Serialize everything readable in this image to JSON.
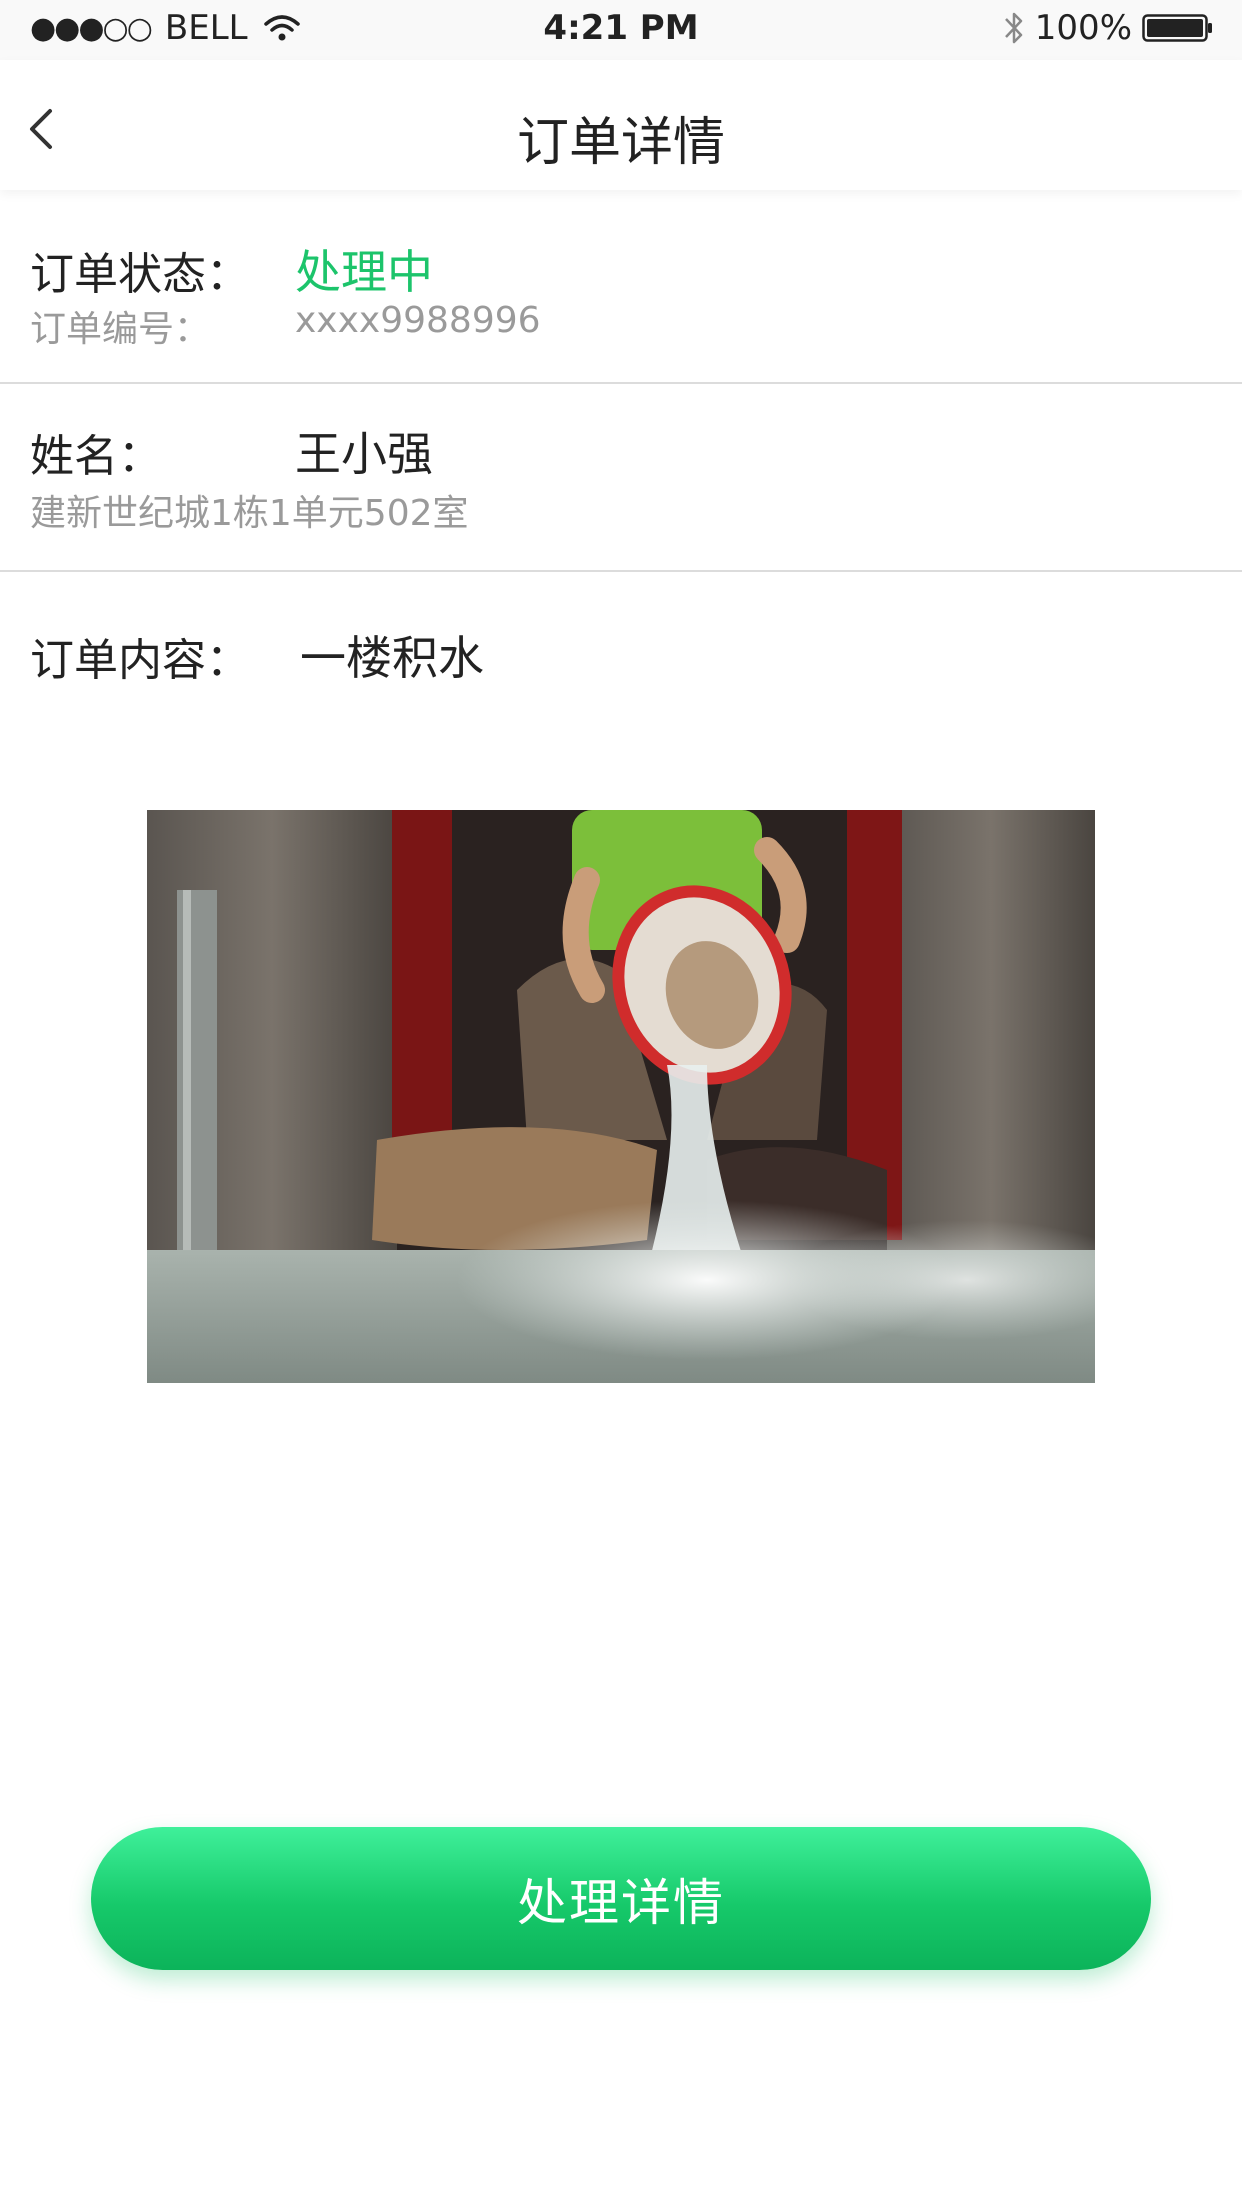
{
  "status_bar": {
    "signal_dots": "●●●○○",
    "carrier": "BELL",
    "time": "4:21 PM",
    "battery": "100%",
    "icons": [
      "wifi-icon",
      "bluetooth-icon",
      "battery-icon"
    ]
  },
  "nav": {
    "title": "订单详情",
    "back_icon": "chevron-left-icon"
  },
  "order": {
    "status_label": "订单状态：",
    "status_value": "处理中",
    "number_label": "订单编号：",
    "number_value": "xxxx9988996"
  },
  "customer": {
    "name_label": "姓名：",
    "name_value": "王小强",
    "address": "建新世纪城1栋1单元502室"
  },
  "content": {
    "label": "订单内容：",
    "value": "一楼积水",
    "photo_subject": "person pouring water out of a bucket at a flooded doorway"
  },
  "action": {
    "button_label": "处理详情"
  },
  "colors": {
    "accent_green": "#1cc46b",
    "button_gradient_top": "#3ff09a",
    "button_gradient_bottom": "#0cb35a",
    "secondary_text": "#9a9a9a"
  }
}
